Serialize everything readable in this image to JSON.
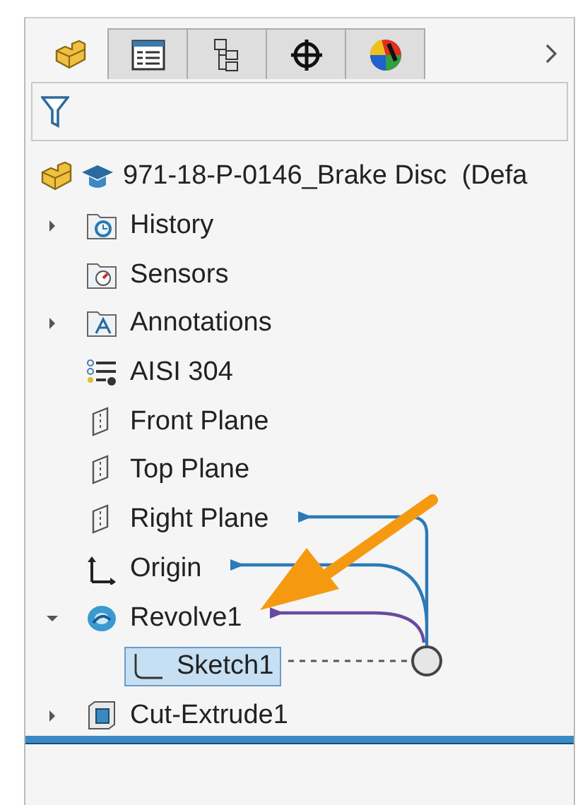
{
  "tabs": [
    {
      "kind": "part",
      "selected": true
    },
    {
      "kind": "properties",
      "selected": false
    },
    {
      "kind": "config",
      "selected": false
    },
    {
      "kind": "target",
      "selected": false
    },
    {
      "kind": "appearance",
      "selected": false
    }
  ],
  "tree": {
    "label": "971-18-P-0146_Brake Disc  (Defa",
    "kind": "part",
    "selected": false,
    "children": [
      {
        "label": "History",
        "kind": "history",
        "expanded": false,
        "selected": false
      },
      {
        "label": "Sensors",
        "kind": "sensors",
        "selected": false
      },
      {
        "label": "Annotations",
        "kind": "annotations",
        "expanded": false,
        "selected": false
      },
      {
        "label": "AISI 304",
        "kind": "material",
        "selected": false
      },
      {
        "label": "Front Plane",
        "kind": "plane",
        "selected": false
      },
      {
        "label": "Top Plane",
        "kind": "plane",
        "selected": false
      },
      {
        "label": "Right Plane",
        "kind": "plane",
        "selected": false
      },
      {
        "label": "Origin",
        "kind": "origin",
        "selected": false
      },
      {
        "label": "Revolve1",
        "kind": "revolve",
        "expanded": true,
        "selected": false,
        "children": [
          {
            "label": "Sketch1",
            "kind": "sketch",
            "selected": true
          }
        ]
      },
      {
        "label": "Cut-Extrude1",
        "kind": "cut",
        "expanded": false,
        "selected": false
      }
    ]
  }
}
